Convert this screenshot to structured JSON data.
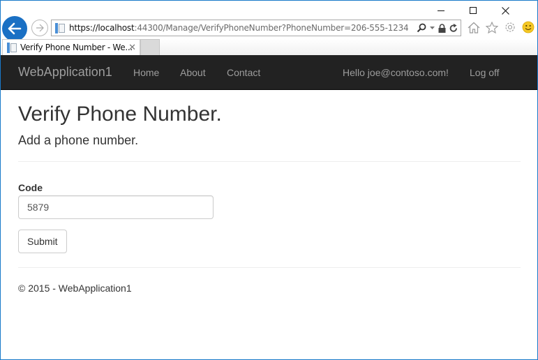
{
  "browser": {
    "url_host": "https://localhost",
    "url_rest": ":44300/Manage/VerifyPhoneNumber?PhoneNumber=206-555-1234",
    "tab_title": "Verify Phone Number - We...",
    "icons": {
      "back": "arrow-left",
      "forward": "arrow-right",
      "search": "search",
      "dropdown": "caret-down",
      "lock": "lock",
      "refresh": "refresh",
      "home": "home",
      "favorites": "star",
      "settings": "gear",
      "feedback": "smiley"
    },
    "caption": {
      "minimize": "—",
      "maximize": "□",
      "close": "✕"
    },
    "tab_close": "✕"
  },
  "navbar": {
    "brand": "WebApplication1",
    "links": [
      {
        "label": "Home"
      },
      {
        "label": "About"
      },
      {
        "label": "Contact"
      }
    ],
    "greeting": "Hello joe@contoso.com!",
    "logoff": "Log off"
  },
  "page": {
    "title": "Verify Phone Number.",
    "subtitle": "Add a phone number.",
    "form": {
      "code_label": "Code",
      "code_value": "5879",
      "submit_label": "Submit"
    },
    "footer": "© 2015 - WebApplication1"
  },
  "colors": {
    "navbar_bg": "#222222",
    "navbar_text": "#9d9d9d",
    "browser_accent": "#1a70c4",
    "text": "#333333"
  }
}
